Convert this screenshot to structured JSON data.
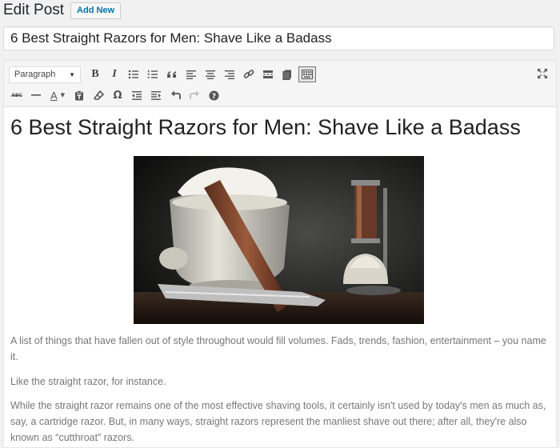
{
  "header": {
    "title": "Edit Post",
    "add_new_label": "Add New"
  },
  "post": {
    "title_value": "6 Best Straight Razors for Men: Shave Like a Badass",
    "content_heading": "6 Best Straight Razors for Men: Shave Like a Badass",
    "paragraphs": [
      "A list of things that have fallen out of style throughout would fill volumes. Fads, trends, fashion, entertainment – you name it.",
      "Like the straight razor, for instance.",
      "While the straight razor remains one of the most effective shaving tools, it certainly isn't used by today's men as much as, say, a cartridge razor. But, in many ways, straight razors represent the manliest shave out there; after all, they're also known as “cutthroat” razors."
    ]
  },
  "toolbar": {
    "format_select_value": "Paragraph",
    "row1_icons": [
      "bold-icon",
      "italic-icon",
      "bulleted-list-icon",
      "numbered-list-icon",
      "blockquote-icon",
      "align-left-icon",
      "align-center-icon",
      "align-right-icon",
      "link-icon",
      "read-more-icon",
      "toolbar-toggle-icon",
      "kitchen-sink-icon"
    ],
    "row2_icons": [
      "strikethrough-icon",
      "horizontal-line-icon",
      "text-color-icon",
      "paste-as-text-icon",
      "clear-formatting-icon",
      "special-character-icon",
      "outdent-icon",
      "indent-icon",
      "undo-icon",
      "redo-icon",
      "help-icon"
    ],
    "bold_glyph": "B",
    "italic_glyph": "I",
    "strike_glyph": "ABC",
    "text_color_glyph": "A",
    "special_char_glyph": "Ω",
    "help_glyph": "?"
  },
  "colors": {
    "accent": "#0073aa",
    "toolbar_bg": "#f5f5f5",
    "page_bg": "#f1f1f1"
  }
}
